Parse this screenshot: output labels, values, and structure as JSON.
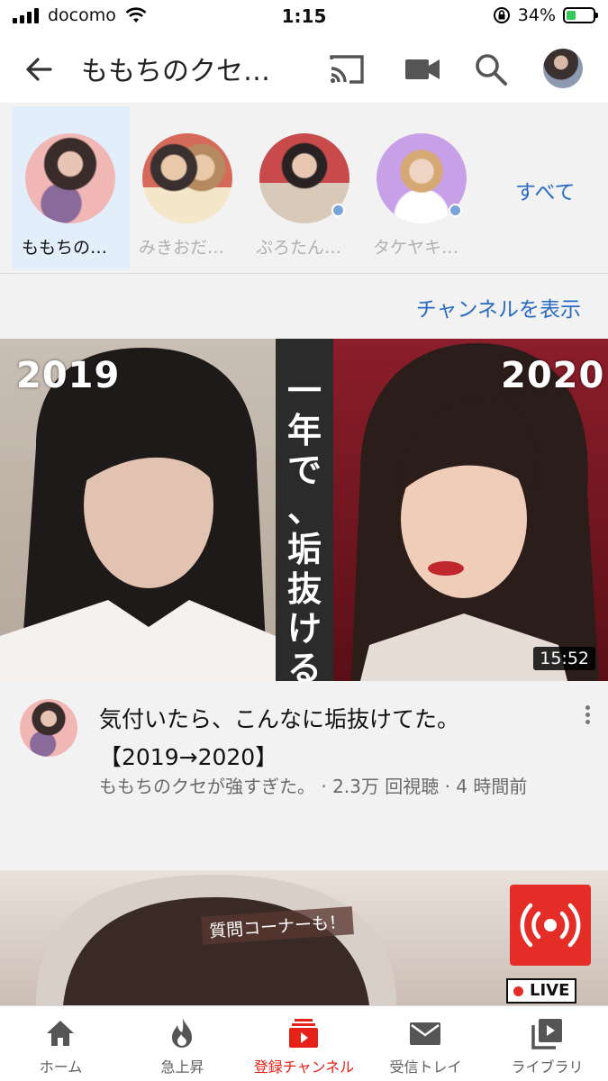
{
  "status_bar": {
    "carrier": "docomo",
    "time": "1:15",
    "battery_percent": "34%",
    "battery_level": 0.34
  },
  "header": {
    "title": "ももちのクセ…",
    "icons": [
      "back-arrow-icon",
      "cast-icon",
      "video-camera-icon",
      "search-icon",
      "account-avatar"
    ]
  },
  "channels": {
    "items": [
      {
        "label": "ももちの…",
        "active": true
      },
      {
        "label": "みきおだ…",
        "active": false
      },
      {
        "label": "ぷろたん…",
        "active": false
      },
      {
        "label": "タケヤキ…",
        "active": false
      }
    ],
    "see_all": "すべて"
  },
  "view_channel": "チャンネルを表示",
  "video": {
    "thumb_year_before": "2019",
    "thumb_year_after": "2020",
    "thumb_caption": "一年で、垢抜ける。",
    "duration": "15:52",
    "title": "気付いたら、こんなに垢抜けてた。【2019→2020】",
    "meta": "ももちのクセが強すぎた。 · 2.3万 回視聴 · 4 時間前"
  },
  "video2": {
    "thumb_tag": "質問コーナーも！",
    "live_label": "LIVE"
  },
  "bottom_nav": {
    "items": [
      {
        "label": "ホーム",
        "icon": "home-icon",
        "active": false
      },
      {
        "label": "急上昇",
        "icon": "trending-flame-icon",
        "active": false
      },
      {
        "label": "登録チャンネル",
        "icon": "subscriptions-icon",
        "active": true
      },
      {
        "label": "受信トレイ",
        "icon": "inbox-mail-icon",
        "active": false
      },
      {
        "label": "ライブラリ",
        "icon": "library-icon",
        "active": false
      }
    ]
  },
  "colors": {
    "accent_blue": "#2a6bc2",
    "brand_red": "#e62117",
    "active_channel_bg": "#e2effb"
  }
}
